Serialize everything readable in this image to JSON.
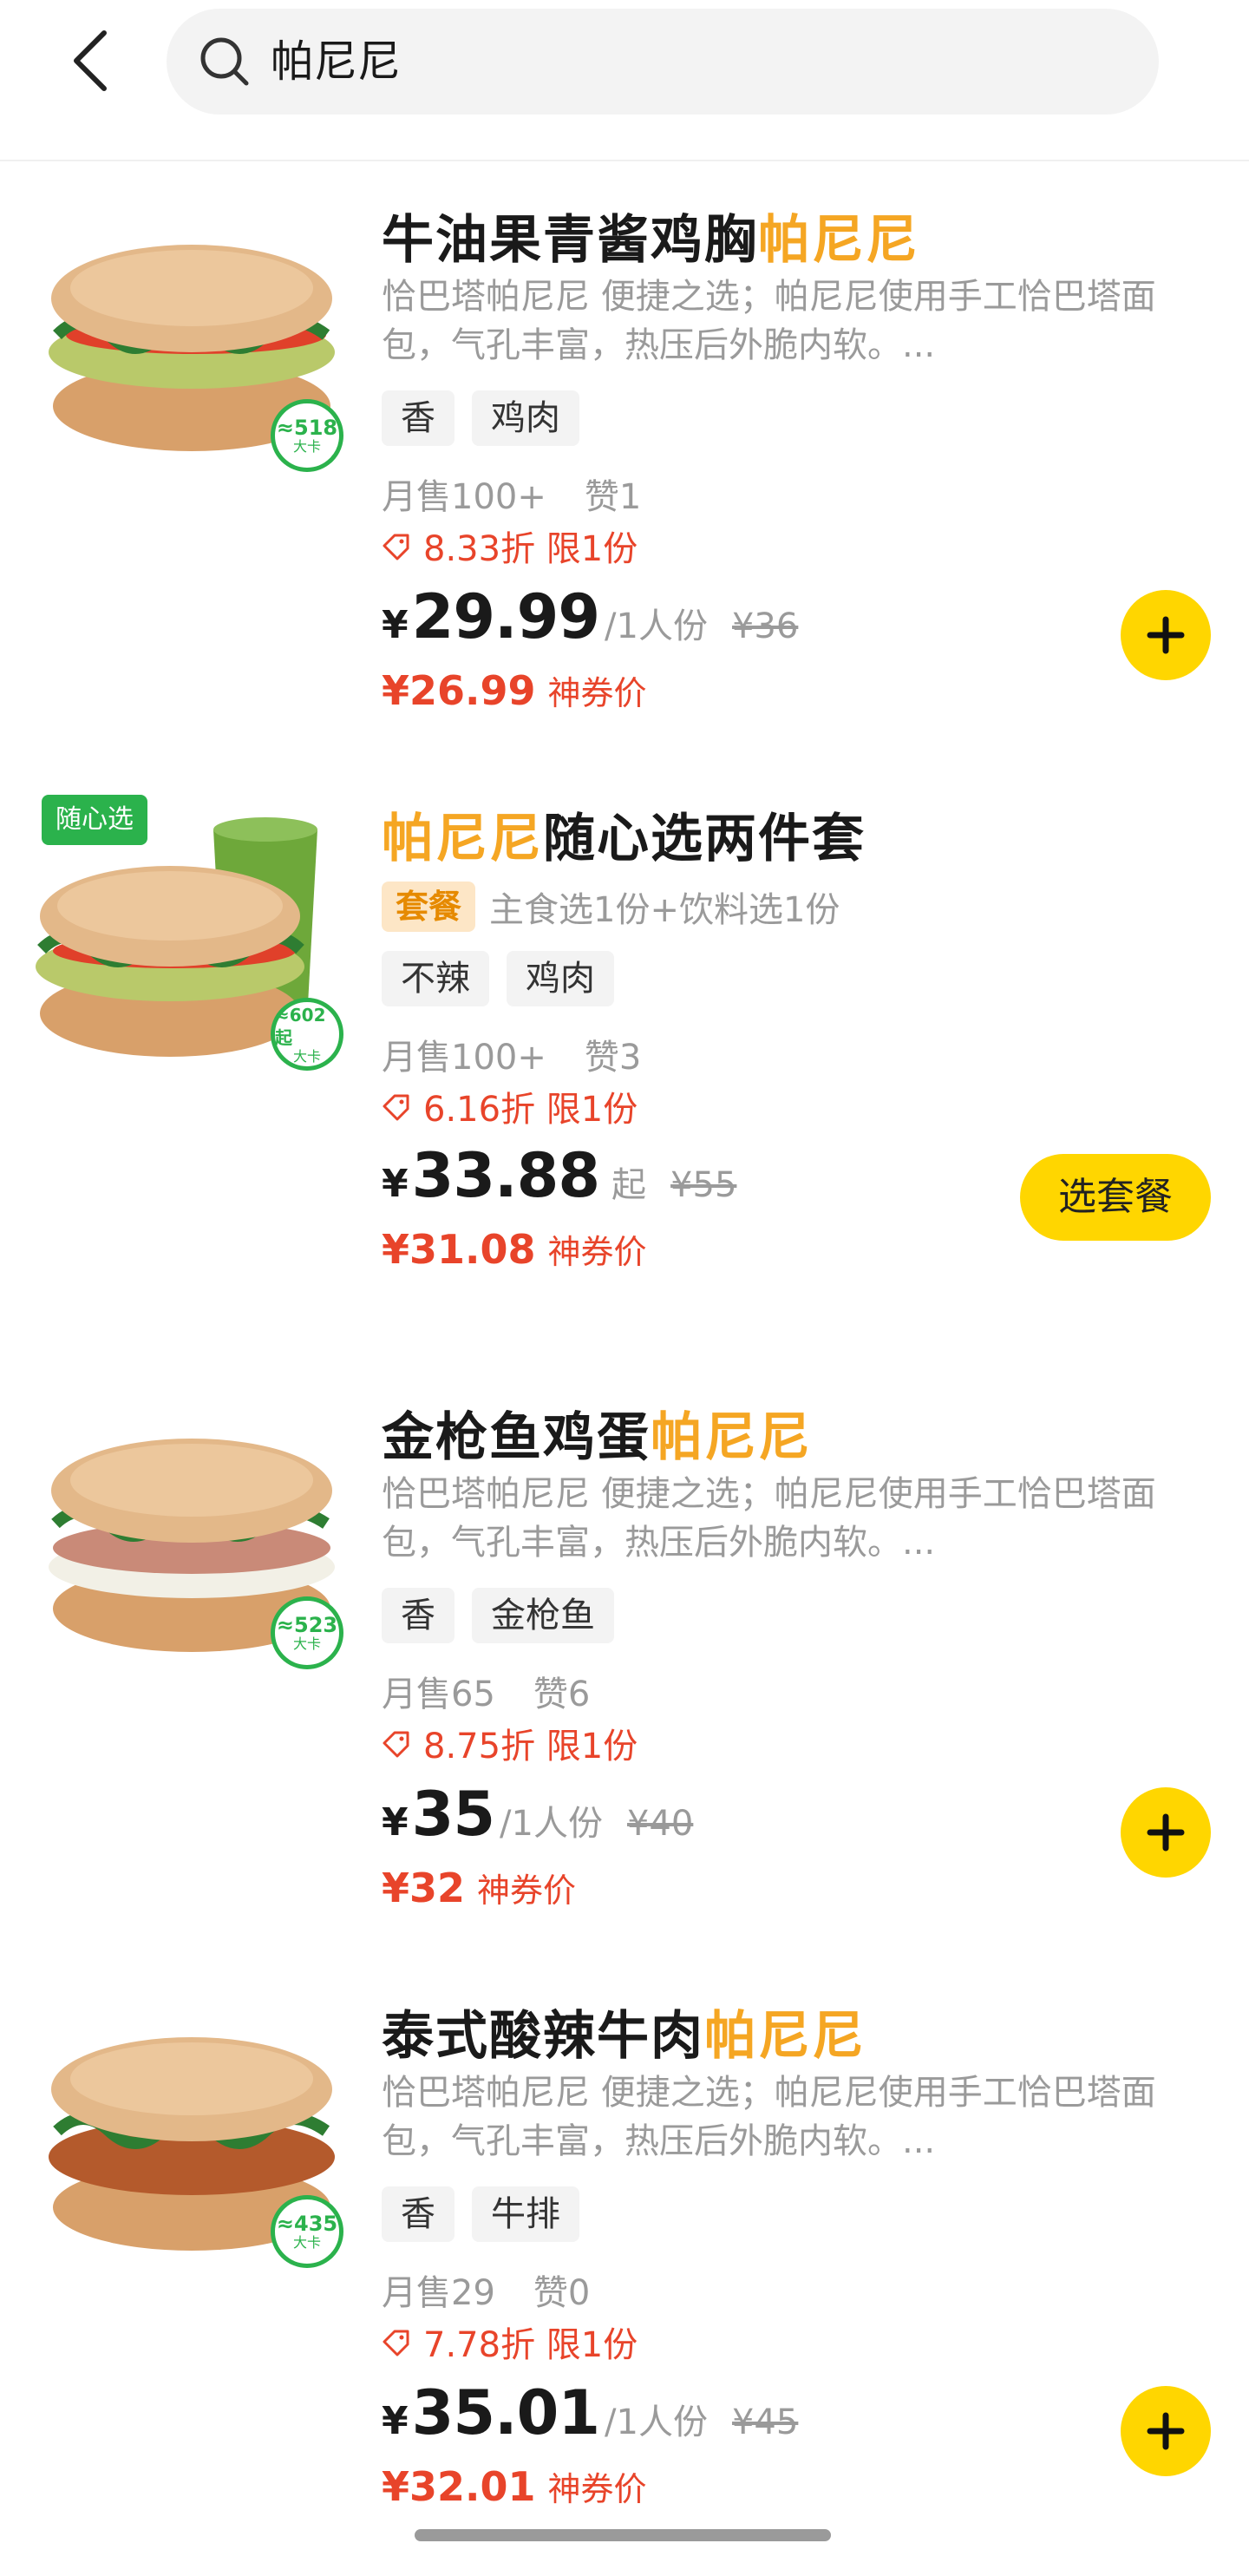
{
  "search": {
    "value": "帕尼尼"
  },
  "products": [
    {
      "title_main": "牛油果青酱鸡胸",
      "title_hl": "帕尼尼",
      "desc": "恰巴塔帕尼尼 便捷之选；帕尼尼使用手工恰巴塔面包，气孔丰富，热压后外脆内软。...",
      "tags": [
        "香",
        "鸡肉"
      ],
      "kcal": "≈518",
      "kcal_unit": "大卡",
      "monthly_sales": "月售100+",
      "likes": "赞1",
      "discount": "8.33折  限1份",
      "yen": "¥",
      "price": "29.99",
      "unit": "/1人份",
      "original_price": "¥36",
      "coupon_price": "¥26.99",
      "coupon_label": "神券价",
      "action": "add"
    },
    {
      "title_main": "随心选两件套",
      "title_hl": "帕尼尼",
      "combo_badge": "套餐",
      "combo_desc": "主食选1份+饮料选1份",
      "corner_badge": "随心选",
      "tags": [
        "不辣",
        "鸡肉"
      ],
      "kcal": "≈602起",
      "kcal_unit": "大卡",
      "monthly_sales": "月售100+",
      "likes": "赞3",
      "discount": "6.16折  限1份",
      "yen": "¥",
      "price": "33.88",
      "unit": "起",
      "original_price": "¥55",
      "coupon_price": "¥31.08",
      "coupon_label": "神券价",
      "action_label": "选套餐"
    },
    {
      "title_main": "金枪鱼鸡蛋",
      "title_hl": "帕尼尼",
      "desc": "恰巴塔帕尼尼 便捷之选；帕尼尼使用手工恰巴塔面包，气孔丰富，热压后外脆内软。...",
      "tags": [
        "香",
        "金枪鱼"
      ],
      "kcal": "≈523",
      "kcal_unit": "大卡",
      "monthly_sales": "月售65",
      "likes": "赞6",
      "discount": "8.75折  限1份",
      "yen": "¥",
      "price": "35",
      "unit": "/1人份",
      "original_price": "¥40",
      "coupon_price": "¥32",
      "coupon_label": "神券价",
      "action": "add"
    },
    {
      "title_main": "泰式酸辣牛肉",
      "title_hl": "帕尼尼",
      "desc": "恰巴塔帕尼尼 便捷之选；帕尼尼使用手工恰巴塔面包，气孔丰富，热压后外脆内软。...",
      "tags": [
        "香",
        "牛排"
      ],
      "kcal": "≈435",
      "kcal_unit": "大卡",
      "monthly_sales": "月售29",
      "likes": "赞0",
      "discount": "7.78折  限1份",
      "yen": "¥",
      "price": "35.01",
      "unit": "/1人份",
      "original_price": "¥45",
      "coupon_price": "¥32.01",
      "coupon_label": "神券价",
      "action": "add"
    }
  ],
  "colors": {
    "accent_yellow": "#ffd600",
    "highlight_orange": "#f5a623",
    "discount_red": "#e8442a",
    "kcal_green": "#2bb24c"
  },
  "icons": [
    "back-arrow-icon",
    "search-icon",
    "discount-tag-icon",
    "plus-icon"
  ]
}
